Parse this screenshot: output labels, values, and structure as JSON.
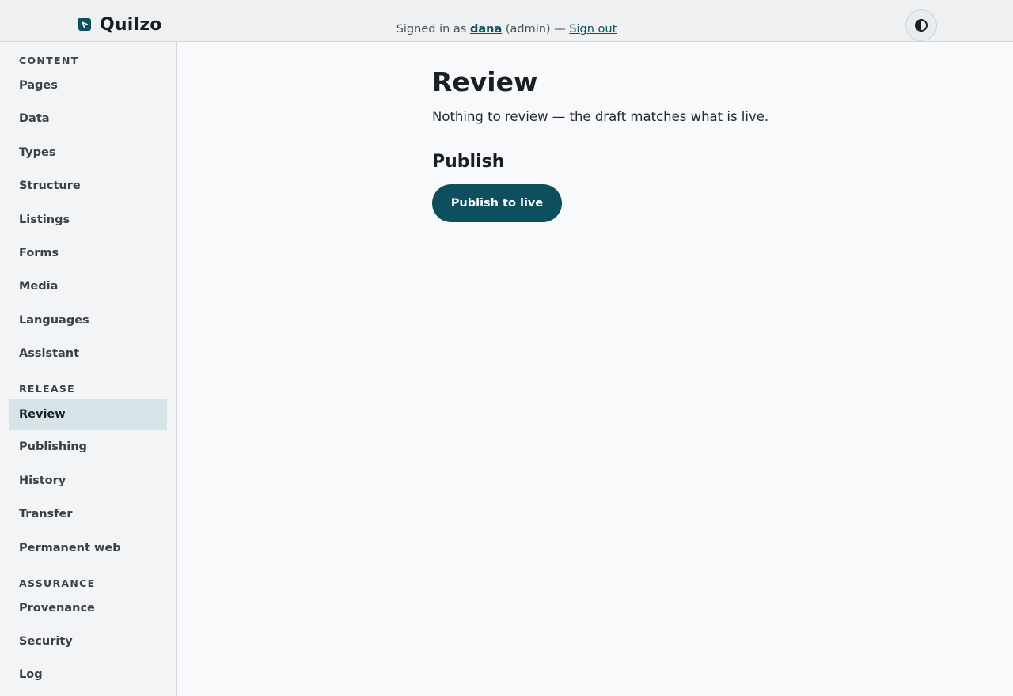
{
  "app": {
    "name": "Quilzo",
    "logo_icon": "quilzo-logo-icon",
    "brand_color": "#0d4f5c"
  },
  "header": {
    "signed_in_prefix": "Signed in as",
    "username": "dana",
    "role": "(admin)",
    "separator": "—",
    "sign_out_label": "Sign out",
    "theme_toggle_icon": "contrast-icon"
  },
  "sidebar": {
    "sections": [
      {
        "heading": "CONTENT",
        "items": [
          {
            "label": "Pages"
          },
          {
            "label": "Data"
          },
          {
            "label": "Types"
          },
          {
            "label": "Structure"
          },
          {
            "label": "Listings"
          },
          {
            "label": "Forms"
          },
          {
            "label": "Media"
          },
          {
            "label": "Languages"
          },
          {
            "label": "Assistant"
          }
        ]
      },
      {
        "heading": "RELEASE",
        "items": [
          {
            "label": "Review",
            "active": true
          },
          {
            "label": "Publishing"
          },
          {
            "label": "History"
          },
          {
            "label": "Transfer"
          },
          {
            "label": "Permanent web"
          }
        ]
      },
      {
        "heading": "ASSURANCE",
        "items": [
          {
            "label": "Provenance"
          },
          {
            "label": "Security"
          },
          {
            "label": "Log"
          }
        ]
      }
    ]
  },
  "main": {
    "title": "Review",
    "status": "Nothing to review — the draft matches what is live.",
    "publish_heading": "Publish",
    "publish_button_label": "Publish to live"
  }
}
